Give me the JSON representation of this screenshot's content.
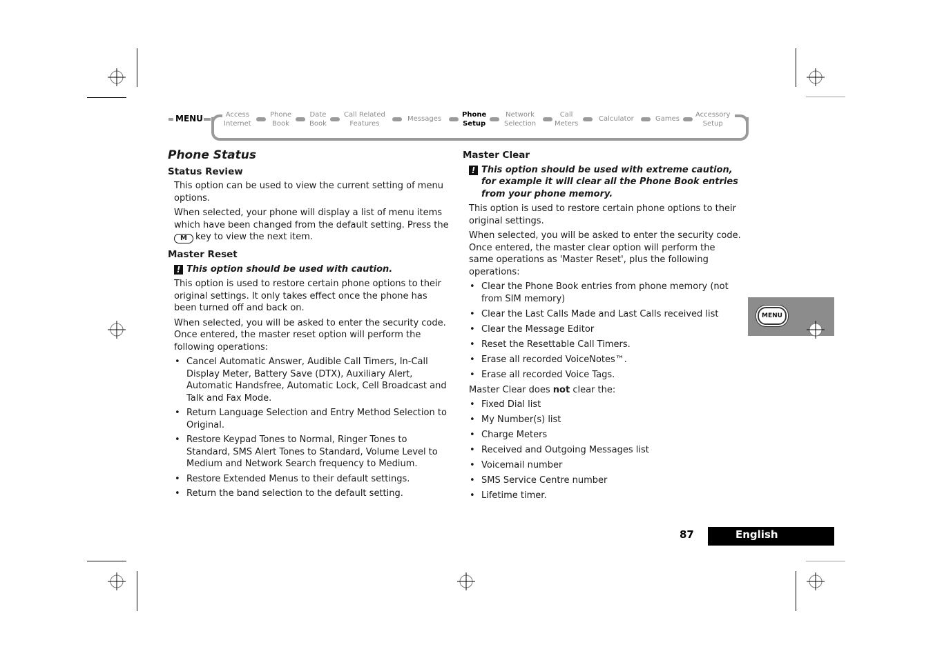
{
  "nav": {
    "menu_label": "MENU",
    "items": [
      {
        "line1": "Access",
        "line2": "Internet",
        "active": false
      },
      {
        "line1": "Phone",
        "line2": "Book",
        "active": false
      },
      {
        "line1": "Date",
        "line2": "Book",
        "active": false
      },
      {
        "line1": "Call Related",
        "line2": "Features",
        "active": false
      },
      {
        "line1": "Messages",
        "line2": "",
        "active": false
      },
      {
        "line1": "Phone",
        "line2": "Setup",
        "active": true
      },
      {
        "line1": "Network",
        "line2": "Selection",
        "active": false
      },
      {
        "line1": "Call",
        "line2": "Meters",
        "active": false
      },
      {
        "line1": "Calculator",
        "line2": "",
        "active": false
      },
      {
        "line1": "Games",
        "line2": "",
        "active": false
      },
      {
        "line1": "Accessory",
        "line2": "Setup",
        "active": false
      }
    ]
  },
  "left": {
    "section_title": "Phone Status",
    "status_review": {
      "heading": "Status Review",
      "p1": "This option can be used to view the current setting of menu options.",
      "p2": "When selected, your phone will display a list of menu items which have been changed from the default setting. Press the",
      "key_label": "M",
      "p2_end": "key to view the next item."
    },
    "master_reset": {
      "heading": "Master Reset",
      "warning_icon": "!",
      "warning": "This option should be used with caution.",
      "p1": "This option is used to restore certain phone options to their original settings. It only takes effect once the phone has been turned off and back on.",
      "p2": "When selected, you will be asked to enter the security code. Once entered, the master reset option will perform the following operations:",
      "bullets": [
        "Cancel Automatic Answer, Audible Call Timers, In-Call Display Meter, Battery Save (DTX), Auxiliary Alert, Automatic Handsfree, Automatic Lock, Cell Broadcast and Talk and Fax Mode.",
        "Return Language Selection and Entry Method Selection to Original.",
        "Restore Keypad Tones to Normal, Ringer Tones to Standard, SMS Alert Tones to Standard, Volume Level to Medium and Network Search frequency to Medium.",
        "Restore Extended Menus to their default settings.",
        "Return the band selection to the default setting."
      ]
    }
  },
  "right": {
    "master_clear": {
      "heading": "Master Clear",
      "warning_icon": "!",
      "warning": "This option should be used with extreme caution, for example it will clear all the Phone Book entries from your phone memory.",
      "p1": "This option is used to restore certain phone options to their original settings.",
      "p2": "When selected, you will be asked to enter the security code. Once entered, the master clear option will perform the same operations as 'Master Reset', plus the following operations:",
      "bullets": [
        "Clear the Phone Book entries from phone memory (not from SIM memory)",
        "Clear the Last Calls Made and Last Calls received list",
        "Clear the Message Editor",
        "Reset the Resettable Call Timers.",
        "Erase all recorded VoiceNotes™.",
        "Erase all recorded Voice Tags."
      ],
      "not_clear_pre": "Master Clear does",
      "not_clear_bold": "not",
      "not_clear_post": "clear the:",
      "not_cleared": [
        "Fixed Dial list",
        "My Number(s) list",
        "Charge Meters",
        "Received and Outgoing Messages list",
        "Voicemail number",
        "SMS Service Centre number",
        "Lifetime timer."
      ]
    }
  },
  "side_tab": {
    "button_label": "MENU"
  },
  "footer": {
    "page_number": "87",
    "language": "English"
  }
}
